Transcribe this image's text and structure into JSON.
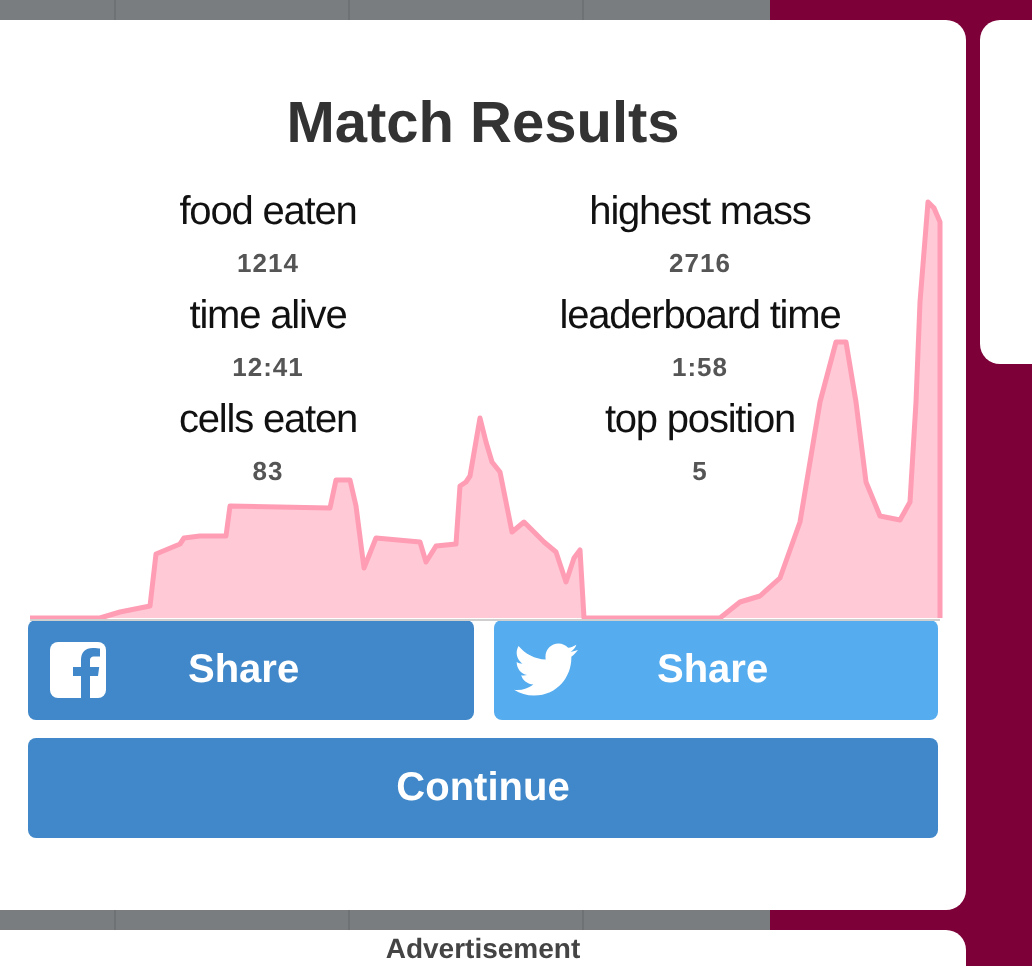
{
  "dialog": {
    "title": "Match Results",
    "stat_columns": [
      [
        {
          "label": "food eaten",
          "value": "1214"
        },
        {
          "label": "time alive",
          "value": "12:41"
        },
        {
          "label": "cells eaten",
          "value": "83"
        }
      ],
      [
        {
          "label": "highest mass",
          "value": "2716"
        },
        {
          "label": "leaderboard time",
          "value": "1:58"
        },
        {
          "label": "top position",
          "value": "5"
        }
      ]
    ],
    "share_buttons": [
      {
        "kind": "facebook",
        "label": "Share"
      },
      {
        "kind": "twitter",
        "label": "Share"
      }
    ],
    "continue_button": "Continue"
  },
  "ad_panel": {
    "title": "Advertisement"
  }
}
